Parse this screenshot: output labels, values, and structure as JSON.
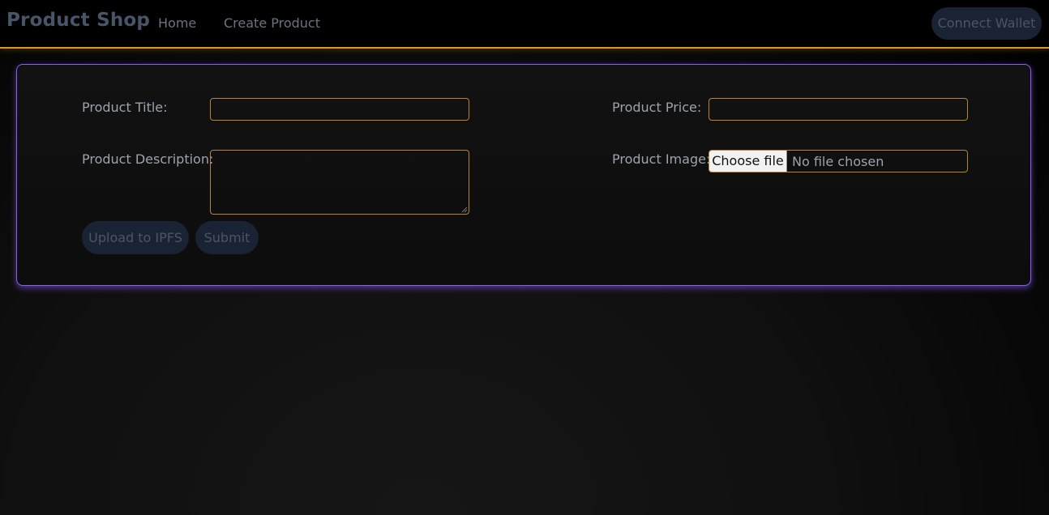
{
  "navbar": {
    "brand": "Product Shop",
    "links": [
      "Home",
      "Create Product"
    ],
    "connect_label": "Connect Wallet"
  },
  "form": {
    "title_label": "Product Title:",
    "title_value": "",
    "description_label": "Product Description:",
    "description_value": "",
    "price_label": "Product Price:",
    "price_value": "",
    "image_label": "Product Image:",
    "file_button_label": "Choose file",
    "file_status": "No file chosen",
    "upload_label": "Upload to IPFS",
    "submit_label": "Submit"
  },
  "colors": {
    "accent_border": "#d99a1f",
    "card_border": "#8b5cf6",
    "button_bg": "#1a2333"
  }
}
